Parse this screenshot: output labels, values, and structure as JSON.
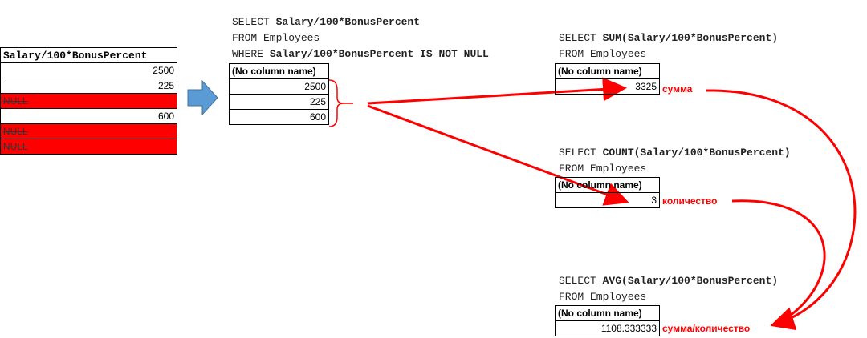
{
  "source_table": {
    "header": "Salary/100*BonusPercent",
    "rows": [
      {
        "value": "2500",
        "null": false
      },
      {
        "value": "225",
        "null": false
      },
      {
        "value": "NULL",
        "null": true
      },
      {
        "value": "600",
        "null": false
      },
      {
        "value": "NULL",
        "null": true
      },
      {
        "value": "NULL",
        "null": true
      }
    ]
  },
  "query_where": {
    "line1_kw": "SELECT ",
    "line1_expr": "Salary/100*BonusPercent",
    "line2": "FROM Employees",
    "line3_kw": "WHERE ",
    "line3_expr": "Salary/100*BonusPercent IS NOT NULL"
  },
  "filtered_table": {
    "header": "(No column name)",
    "rows": [
      "2500",
      "225",
      "600"
    ]
  },
  "query_sum": {
    "line1_kw": "SELECT ",
    "line1_expr": "SUM(Salary/100*BonusPercent)",
    "line2": "FROM Employees",
    "header": "(No column name)",
    "value": "3325",
    "label": "сумма"
  },
  "query_count": {
    "line1_kw": "SELECT ",
    "line1_expr": "COUNT(Salary/100*BonusPercent)",
    "line2": "FROM Employees",
    "header": "(No column name)",
    "value": "3",
    "label": "количество"
  },
  "query_avg": {
    "line1_kw": "SELECT ",
    "line1_expr": "AVG(Salary/100*BonusPercent)",
    "line2": "FROM Employees",
    "header": "(No column name)",
    "value": "1108.333333",
    "label": "сумма/количество"
  },
  "colors": {
    "null_fill": "#ff0000",
    "arrow_red": "#ff0000",
    "block_arrow": "#5b9bd5"
  }
}
